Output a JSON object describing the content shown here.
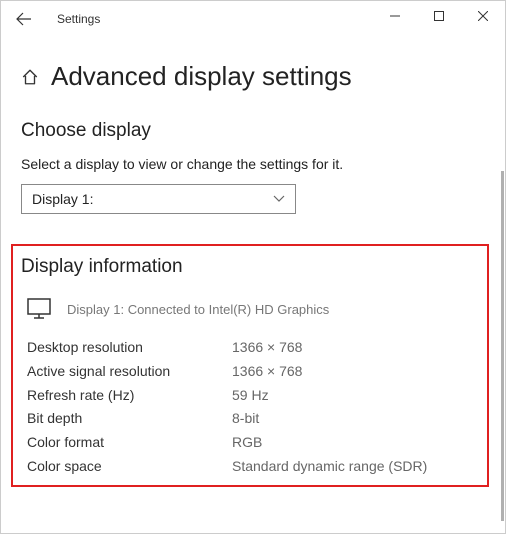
{
  "titlebar": {
    "title": "Settings"
  },
  "page": {
    "title": "Advanced display settings"
  },
  "choose": {
    "heading": "Choose display",
    "desc": "Select a display to view or change the settings for it.",
    "selected": "Display 1:"
  },
  "info": {
    "heading": "Display information",
    "connected": "Display 1: Connected to Intel(R) HD Graphics",
    "rows": [
      {
        "label": "Desktop resolution",
        "value": "1366 × 768"
      },
      {
        "label": "Active signal resolution",
        "value": "1366 × 768"
      },
      {
        "label": "Refresh rate (Hz)",
        "value": "59 Hz"
      },
      {
        "label": "Bit depth",
        "value": "8-bit"
      },
      {
        "label": "Color format",
        "value": "RGB"
      },
      {
        "label": "Color space",
        "value": "Standard dynamic range (SDR)"
      }
    ]
  }
}
